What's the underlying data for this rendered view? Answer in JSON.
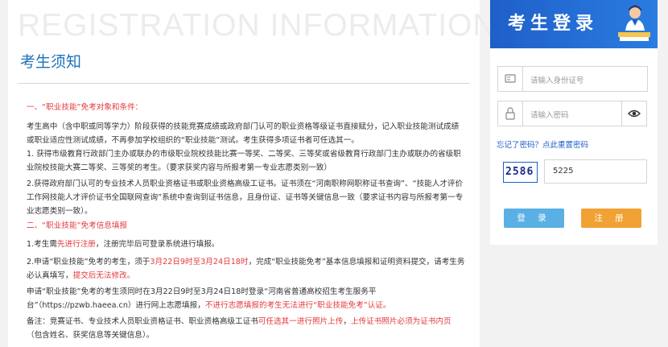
{
  "header": {
    "watermark": "REGISTRATION INFORMATION",
    "title": "考生须知"
  },
  "notice": {
    "section1_title": "一、“职业技能”免考对象和条件：",
    "p1": "考生高中（含中职或同等学力）阶段获得的技能竞赛成绩或政府部门认可的职业资格等级证书直接赋分，记入职业技能测试成绩或职业适应性测试成绩，不再参加学校组织的“职业技能”测试。考生获得多项证书者可任选其一。",
    "p2": "1. 获得市级教育行政部门主办或联办的市级职业院校技能比赛一等奖、二等奖、三等奖或省级教育行政部门主办或联办的省级职业院校技能大赛二等奖、三等奖的考生。（要求获奖内容与所报考第一专业志愿类别一致）",
    "p3": "2.获得政府部门认可的专业技术人员职业资格证书或职业资格高级工证书。证书须在“河南职称网职称证书查询”、“技能人才评价工作网技能人才评价证书全国联网查询”系统中查询到证书信息，且身份证、证书等关键信息一致（要求证书内容与所报考第一专业志愿类别一致）。",
    "section2_title": "二、“职业技能”免考信息填报",
    "p4_a": "1.考生需",
    "p4_red": "先进行注册",
    "p4_b": "，注册完毕后可登录系统进行填报。",
    "p5_a": "2.申请“职业技能”免考的考生，须于",
    "p5_red1": "3月22日9时至3月24日18时",
    "p5_b": "，完成“职业技能免考”基本信息填报和证明资料提交，请考生务必认真填写，",
    "p5_red2": "提交后无法修改。",
    "p6_a": "申请“职业技能”免考的考生须同时在3月22日9时至3月24日18时登录“河南省普通高校招生考生服务平台”（https://pzwb.haeea.cn）进行网上志愿填报，",
    "p6_red": "不进行志愿填报的考生无法进行“职业技能免考”认证。",
    "p7_a": "备注：竞赛证书、专业技术人员职业资格证书、职业资格高级工证书",
    "p7_red1": "可任选其一进行照片上传",
    "p7_b": "，",
    "p7_red2": "上传证书照片必须为证书内页",
    "p7_c": "（包含姓名、获奖信息等关键信息）。"
  },
  "login": {
    "banner_title": "考生登录",
    "id_placeholder": "请输入身份证号",
    "password_placeholder": "请输入密码",
    "forgot_link": "忘记了密码？点此重置密码",
    "captcha_image_text": "2586",
    "captcha_value": "5225",
    "login_button": "登 录",
    "register_button": "注 册"
  },
  "colors": {
    "accent_blue": "#1f5fc9",
    "notice_red": "#e4393c",
    "login_button": "#5ab0e4",
    "register_button": "#f2a134"
  }
}
